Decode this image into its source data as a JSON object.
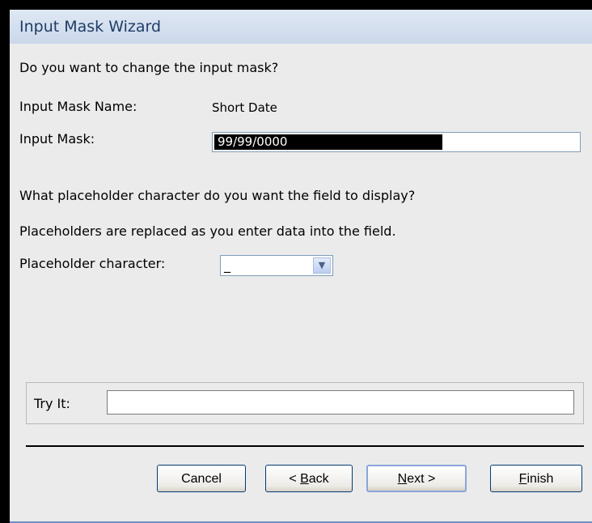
{
  "window": {
    "title": "Input Mask Wizard"
  },
  "prompt": "Do you want to change the input mask?",
  "mask_name": {
    "label": "Input Mask Name:",
    "value": "Short Date"
  },
  "mask": {
    "label": "Input Mask:",
    "value": "99/99/0000"
  },
  "placeholder_question": "What placeholder character do you want the field to display?",
  "placeholder_note": "Placeholders are replaced as you enter data into the field.",
  "placeholder": {
    "label": "Placeholder character:",
    "value": "_"
  },
  "try_it": {
    "label": "Try It:",
    "value": ""
  },
  "buttons": {
    "cancel": "Cancel",
    "back_prefix": "< ",
    "back_hotkey": "B",
    "back_rest": "ack",
    "next_hotkey": "N",
    "next_rest": "ext >",
    "finish_hotkey": "F",
    "finish_rest": "inish"
  },
  "icons": {
    "dropdown": "chevron-down-icon"
  }
}
